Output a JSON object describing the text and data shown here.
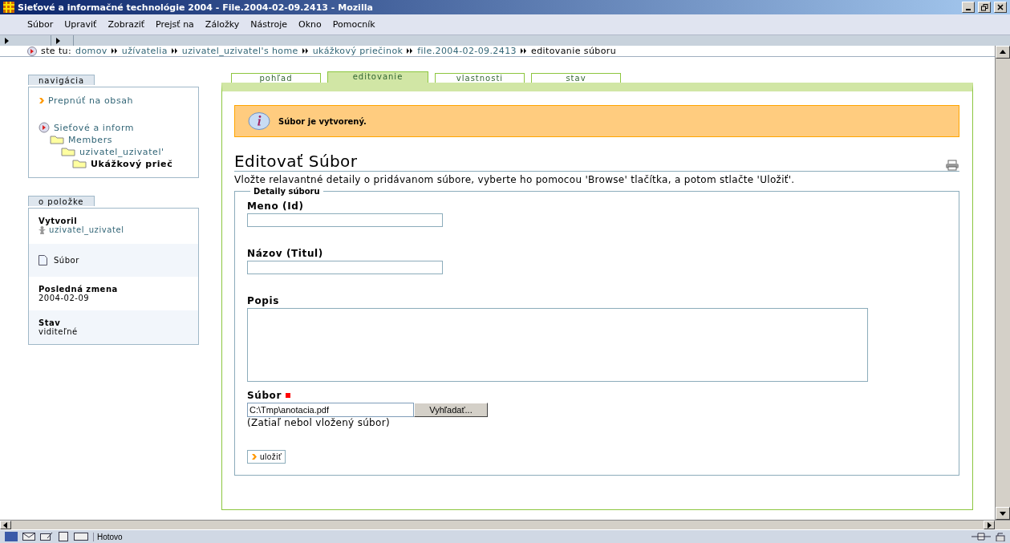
{
  "window": {
    "title": "Sieťové a informačné technológie 2004 - File.2004-02-09.2413 - Mozilla"
  },
  "menu": [
    "Súbor",
    "Upraviť",
    "Zobraziť",
    "Prejsť na",
    "Záložky",
    "Nástroje",
    "Okno",
    "Pomocník"
  ],
  "breadcrumb": {
    "prefix": "ste tu:",
    "items": [
      {
        "label": "domov",
        "current": false
      },
      {
        "label": "užívatelia",
        "current": false
      },
      {
        "label": "uzivatel_uzivatel's home",
        "current": false
      },
      {
        "label": "ukážkový priečinok",
        "current": false
      },
      {
        "label": "file.2004-02-09.2413",
        "current": false
      },
      {
        "label": "editovanie súboru",
        "current": true
      }
    ]
  },
  "navigation": {
    "title": "navigácia",
    "skip_link": "Prepnúť na obsah",
    "tree": [
      {
        "label": "Sieťové a inform",
        "kind": "site",
        "selected": false,
        "children": [
          {
            "label": "Members",
            "kind": "folder",
            "selected": false,
            "children": [
              {
                "label": "uzivatel_uzivatel'",
                "kind": "folder",
                "selected": false,
                "children": [
                  {
                    "label": "Ukážkový prieč",
                    "kind": "folder",
                    "selected": true
                  }
                ]
              }
            ]
          }
        ]
      }
    ]
  },
  "about": {
    "title": "o položke",
    "items": [
      {
        "kind": "creator",
        "label": "Vytvoril",
        "value": "uzivatel_uzivatel"
      },
      {
        "kind": "type",
        "value": "Súbor"
      },
      {
        "kind": "field",
        "label": "Posledná zmena",
        "value": "2004-02-09"
      },
      {
        "kind": "field",
        "label": "Stav",
        "value": "viditeľné"
      }
    ]
  },
  "tabs": [
    {
      "label": "pohľad",
      "selected": false
    },
    {
      "label": "editovanie",
      "selected": true
    },
    {
      "label": "vlastnosti",
      "selected": false
    },
    {
      "label": "stav",
      "selected": false
    }
  ],
  "message": "Súbor je vytvorený.",
  "heading": "Editovať Súbor",
  "description": "Vložte relavantné detaily o pridávanom súbore, vyberte ho pomocou 'Browse' tlačítka, a potom stlačte 'Uložiť'.",
  "fieldset": {
    "legend": "Detaily súboru",
    "fields": [
      {
        "kind": "text",
        "label": "Meno (Id)",
        "required": false
      },
      {
        "kind": "text",
        "label": "Názov (Titul)",
        "required": false
      },
      {
        "kind": "textarea",
        "label": "Popis",
        "required": false
      },
      {
        "kind": "file",
        "label": "Súbor",
        "required": true,
        "value": "C:\\Tmp\\anotacia.pdf",
        "button": "Vyhľadať...",
        "note": "(Zatiaľ nebol vložený súbor)"
      }
    ]
  },
  "save_button": "uložiť",
  "status_bar": {
    "text": "Hotovo"
  }
}
